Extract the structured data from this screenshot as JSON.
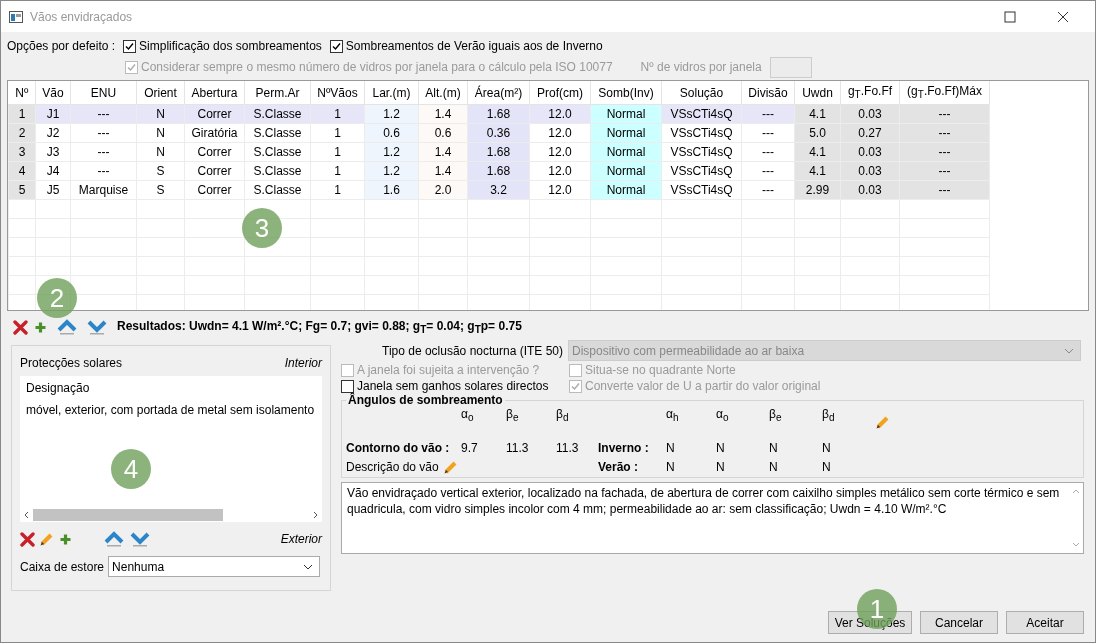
{
  "window": {
    "title": "Vãos envidraçados"
  },
  "defaults": {
    "label": "Opções por defeito :",
    "options": [
      {
        "label": "Simplificação dos sombreamentos",
        "checked": true,
        "disabled": false
      },
      {
        "label": "Sombreamentos de Verão iguais aos de Inverno",
        "checked": true,
        "disabled": false
      }
    ],
    "iso_option": {
      "label": "Considerar sempre o mesmo número de vidros por janela para o cálculo pela ISO 10077",
      "checked": true,
      "disabled": true
    },
    "glass_count": {
      "label": "Nº de vidros por janela",
      "disabled": true
    }
  },
  "table": {
    "columns": [
      {
        "label": "Nº",
        "color": "#e3e3e3"
      },
      {
        "label": "Vão"
      },
      {
        "label": "ENU"
      },
      {
        "label": "Orient"
      },
      {
        "label": "Abertura"
      },
      {
        "label": "Perm.Ar"
      },
      {
        "label": "NºVãos"
      },
      {
        "label": "Lar.(m)",
        "color": "#eef5fc"
      },
      {
        "label": "Alt.(m)",
        "color": "#fdf9f6"
      },
      {
        "label": "Área(m²)",
        "color": "#e4e4f8"
      },
      {
        "label": "Prof(cm)"
      },
      {
        "label": "Somb(Inv)",
        "color": "#ccffff"
      },
      {
        "label": "Solução"
      },
      {
        "label": "Divisão"
      },
      {
        "label": "Uwdn",
        "color": "#e3e3e3"
      },
      {
        "label": "g$_{T}$.Fo.Ff",
        "color": "#e3e3e3"
      },
      {
        "label": "(g$_{T}$.Fo.Ff)Máx",
        "color": "#e3e3e3"
      }
    ],
    "rows": [
      {
        "selected": true,
        "cells": [
          "1",
          "J1",
          "---",
          "N",
          "Correr",
          "S.Classe",
          "1",
          "1.2",
          "1.4",
          "1.68",
          "12.0",
          "Normal",
          "VSsCTi4sQ",
          "---",
          "4.1",
          "0.03",
          "---"
        ]
      },
      {
        "selected": false,
        "cells": [
          "2",
          "J2",
          "---",
          "N",
          "Giratória",
          "S.Classe",
          "1",
          "0.6",
          "0.6",
          "0.36",
          "12.0",
          "Normal",
          "VSsCTi4sQ",
          "---",
          "5.0",
          "0.27",
          "---"
        ]
      },
      {
        "selected": false,
        "cells": [
          "3",
          "J3",
          "---",
          "N",
          "Correr",
          "S.Classe",
          "1",
          "1.2",
          "1.4",
          "1.68",
          "12.0",
          "Normal",
          "VSsCTi4sQ",
          "---",
          "4.1",
          "0.03",
          "---"
        ]
      },
      {
        "selected": false,
        "cells": [
          "4",
          "J4",
          "---",
          "S",
          "Correr",
          "S.Classe",
          "1",
          "1.2",
          "1.4",
          "1.68",
          "12.0",
          "Normal",
          "VSsCTi4sQ",
          "---",
          "4.1",
          "0.03",
          "---"
        ]
      },
      {
        "selected": false,
        "cells": [
          "5",
          "J5",
          "Marquise",
          "S",
          "Correr",
          "S.Classe",
          "1",
          "1.6",
          "2.0",
          "3.2",
          "12.0",
          "Normal",
          "VSsCTi4sQ",
          "---",
          "2.99",
          "0.03",
          "---"
        ]
      }
    ]
  },
  "results": "Resultados: Uwdn= 4.1 W/m².°C; Fg= 0.7; gvi= 0.88; g$_{T}$= 0.04; g$_{T}$p= 0.75",
  "solar_protection": {
    "title": "Protecções solares",
    "interior_label": "Interior",
    "exterior_label": "Exterior",
    "header": "Designação",
    "items": [
      "móvel, exterior, com portada de metal sem isolamento"
    ],
    "blind_box": {
      "label": "Caixa de estore",
      "value": "Nenhuma"
    }
  },
  "night_occlusion": {
    "label": "Tipo de oclusão nocturna (ITE 50)",
    "value": "Dispositivo com permeabilidade ao ar baixa",
    "disabled": true
  },
  "checks": [
    {
      "label": "A janela foi sujeita a intervenção ?",
      "checked": false,
      "disabled": true
    },
    {
      "label": "Situa-se no quadrante Norte",
      "checked": false,
      "disabled": true
    },
    {
      "label": "Janela sem ganhos solares directos",
      "checked": false,
      "disabled": false
    },
    {
      "label": "Converte valor de U a partir do valor original",
      "checked": true,
      "disabled": true
    }
  ],
  "angles": {
    "title": "Ângulos de sombreamento",
    "contour_headers": [
      "α$_{o}$",
      "β$_{e}$",
      "β$_{d}$"
    ],
    "season_headers": [
      "α$_{h}$",
      "α$_{o}$",
      "β$_{e}$",
      "β$_{d}$"
    ],
    "contour_label": "Contorno do vão :",
    "contour_values": [
      "9.7",
      "11.3",
      "11.3"
    ],
    "winter_label": "Inverno :",
    "winter_values": [
      "N",
      "N",
      "N",
      "N"
    ],
    "summer_label": "Verão :",
    "summer_values": [
      "N",
      "N",
      "N",
      "N"
    ],
    "description_label": "Descrição do vão"
  },
  "description": "Vão envidraçado vertical exterior, localizado na fachada, de abertura de correr com caixilho simples metálico sem corte térmico e sem quadricula, com vidro simples incolor com 4 mm; permeabilidade ao ar: sem classificação; Uwdn = 4.10 W/m².°C",
  "buttons": [
    "Ver Soluções",
    "Cancelar",
    "Aceitar"
  ],
  "callouts": [
    "1",
    "2",
    "3",
    "4"
  ]
}
